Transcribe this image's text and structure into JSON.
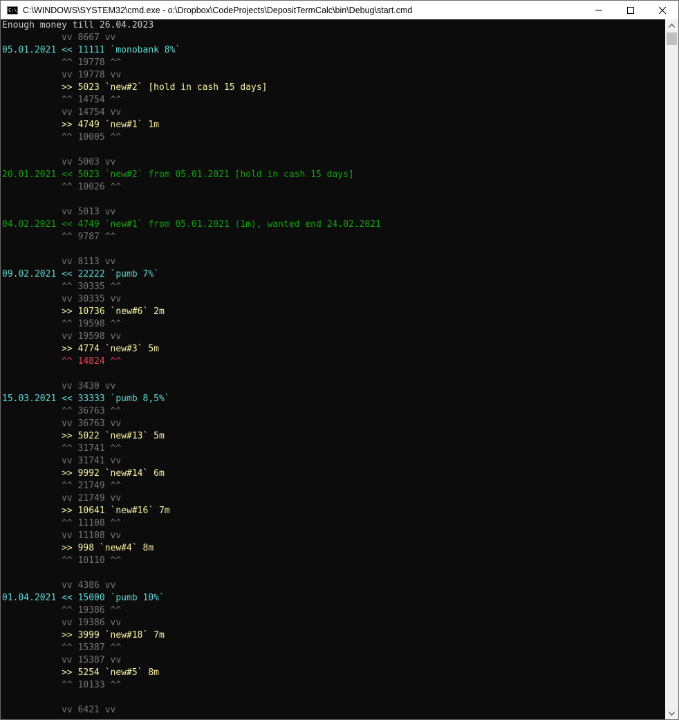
{
  "window": {
    "title": "C:\\WINDOWS\\SYSTEM32\\cmd.exe - o:\\Dropbox\\CodeProjects\\DepositTermCalc\\bin\\Debug\\start.cmd",
    "icon_text": "C:\\",
    "icon": "cmd-icon"
  },
  "controls": {
    "minimize": "minimize-icon",
    "maximize": "maximize-icon",
    "close": "close-icon"
  },
  "colors": {
    "background": "#0c0c0c",
    "gray": "#767676",
    "white": "#cccccc",
    "cyan": "#61d6d6",
    "yellow": "#f9f1a5",
    "green": "#13a10e",
    "red": "#e74856"
  },
  "console": {
    "lines": [
      [
        {
          "t": "Enough money till 26.04.2023",
          "c": "white"
        }
      ],
      [
        {
          "t": "           vv 8667 vv",
          "c": "gray"
        }
      ],
      [
        {
          "t": "05.01.2021 << 11111 `monobank 8%`",
          "c": "cyan"
        }
      ],
      [
        {
          "t": "           ^^ 19778 ^^",
          "c": "gray"
        }
      ],
      [
        {
          "t": "           vv 19778 vv",
          "c": "gray"
        }
      ],
      [
        {
          "t": "           >> 5023 `new#2` [hold in cash 15 days]",
          "c": "yellow"
        }
      ],
      [
        {
          "t": "           ^^ 14754 ^^",
          "c": "gray"
        }
      ],
      [
        {
          "t": "           vv 14754 vv",
          "c": "gray"
        }
      ],
      [
        {
          "t": "           >> 4749 `new#1` 1m",
          "c": "yellow"
        }
      ],
      [
        {
          "t": "           ^^ 10005 ^^",
          "c": "gray"
        }
      ],
      [
        {
          "t": "",
          "c": "gray"
        }
      ],
      [
        {
          "t": "           vv 5003 vv",
          "c": "gray"
        }
      ],
      [
        {
          "t": "20.01.2021 << 5023 `new#2` from 05.01.2021 [hold in cash 15 days]",
          "c": "green"
        }
      ],
      [
        {
          "t": "           ^^ 10026 ^^",
          "c": "gray"
        }
      ],
      [
        {
          "t": "",
          "c": "gray"
        }
      ],
      [
        {
          "t": "           vv 5013 vv",
          "c": "gray"
        }
      ],
      [
        {
          "t": "04.02.2021 << 4749 `new#1` from 05.01.2021 (1m), wanted end 24.02.2021",
          "c": "green"
        }
      ],
      [
        {
          "t": "           ^^ 9787 ^^",
          "c": "gray"
        }
      ],
      [
        {
          "t": "",
          "c": "gray"
        }
      ],
      [
        {
          "t": "           vv 8113 vv",
          "c": "gray"
        }
      ],
      [
        {
          "t": "09.02.2021 << 22222 `pumb 7%`",
          "c": "cyan"
        }
      ],
      [
        {
          "t": "           ^^ 30335 ^^",
          "c": "gray"
        }
      ],
      [
        {
          "t": "           vv 30335 vv",
          "c": "gray"
        }
      ],
      [
        {
          "t": "           >> 10736 `new#6` 2m",
          "c": "yellow"
        }
      ],
      [
        {
          "t": "           ^^ 19598 ^^",
          "c": "gray"
        }
      ],
      [
        {
          "t": "           vv 19598 vv",
          "c": "gray"
        }
      ],
      [
        {
          "t": "           >> 4774 `new#3` 5m",
          "c": "yellow"
        }
      ],
      [
        {
          "t": "           ^^ 14824 ^^",
          "c": "red"
        }
      ],
      [
        {
          "t": "",
          "c": "gray"
        }
      ],
      [
        {
          "t": "           vv 3430 vv",
          "c": "gray"
        }
      ],
      [
        {
          "t": "15.03.2021 << 33333 `pumb 8,5%`",
          "c": "cyan"
        }
      ],
      [
        {
          "t": "           ^^ 36763 ^^",
          "c": "gray"
        }
      ],
      [
        {
          "t": "           vv 36763 vv",
          "c": "gray"
        }
      ],
      [
        {
          "t": "           >> 5022 `new#13` 5m",
          "c": "yellow"
        }
      ],
      [
        {
          "t": "           ^^ 31741 ^^",
          "c": "gray"
        }
      ],
      [
        {
          "t": "           vv 31741 vv",
          "c": "gray"
        }
      ],
      [
        {
          "t": "           >> 9992 `new#14` 6m",
          "c": "yellow"
        }
      ],
      [
        {
          "t": "           ^^ 21749 ^^",
          "c": "gray"
        }
      ],
      [
        {
          "t": "           vv 21749 vv",
          "c": "gray"
        }
      ],
      [
        {
          "t": "           >> 10641 `new#16` 7m",
          "c": "yellow"
        }
      ],
      [
        {
          "t": "           ^^ 11108 ^^",
          "c": "gray"
        }
      ],
      [
        {
          "t": "           vv 11108 vv",
          "c": "gray"
        }
      ],
      [
        {
          "t": "           >> 998 `new#4` 8m",
          "c": "yellow"
        }
      ],
      [
        {
          "t": "           ^^ 10110 ^^",
          "c": "gray"
        }
      ],
      [
        {
          "t": "",
          "c": "gray"
        }
      ],
      [
        {
          "t": "           vv 4386 vv",
          "c": "gray"
        }
      ],
      [
        {
          "t": "01.04.2021 << 15000 `pumb 10%`",
          "c": "cyan"
        }
      ],
      [
        {
          "t": "           ^^ 19386 ^^",
          "c": "gray"
        }
      ],
      [
        {
          "t": "           vv 19386 vv",
          "c": "gray"
        }
      ],
      [
        {
          "t": "           >> 3999 `new#18` 7m",
          "c": "yellow"
        }
      ],
      [
        {
          "t": "           ^^ 15387 ^^",
          "c": "gray"
        }
      ],
      [
        {
          "t": "           vv 15387 vv",
          "c": "gray"
        }
      ],
      [
        {
          "t": "           >> 5254 `new#5` 8m",
          "c": "yellow"
        }
      ],
      [
        {
          "t": "           ^^ 10133 ^^",
          "c": "gray"
        }
      ],
      [
        {
          "t": "",
          "c": "gray"
        }
      ],
      [
        {
          "t": "           vv 6421 vv",
          "c": "gray"
        }
      ]
    ]
  },
  "scrollbar": {
    "up": "scroll-up-arrow-icon",
    "down": "scroll-down-arrow-icon"
  }
}
